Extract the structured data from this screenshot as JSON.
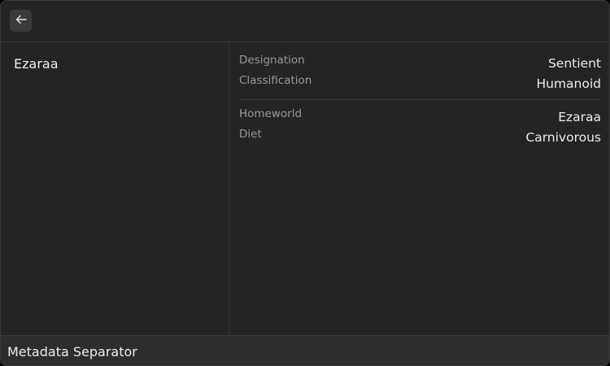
{
  "header": {
    "back_icon": "arrow-left-icon"
  },
  "sidebar": {
    "items": [
      {
        "label": "Ezaraa"
      }
    ]
  },
  "details": {
    "groups": [
      {
        "rows": [
          {
            "label": "Designation",
            "value": "Sentient"
          },
          {
            "label": "Classification",
            "value": "Humanoid"
          }
        ]
      },
      {
        "rows": [
          {
            "label": "Homeworld",
            "value": "Ezaraa"
          },
          {
            "label": "Diet",
            "value": "Carnivorous"
          }
        ]
      }
    ]
  },
  "footer": {
    "label": "Metadata Separator"
  }
}
